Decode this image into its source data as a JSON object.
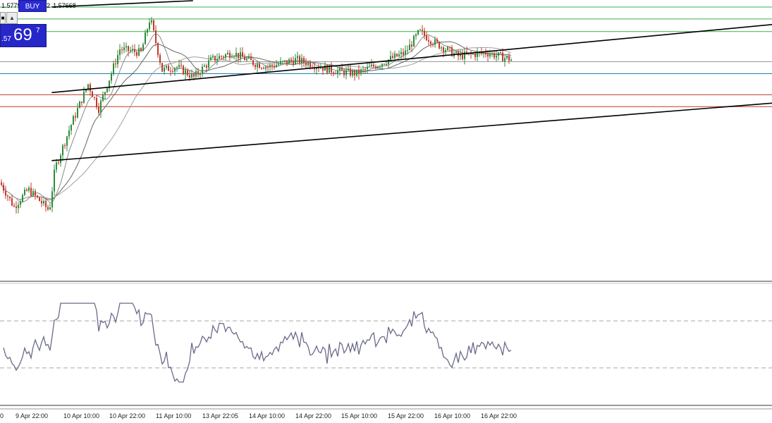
{
  "ohlc": {
    "values": [
      "1.57791",
      "1.57662",
      "1.57668"
    ]
  },
  "trade_panel": {
    "menu_glyph": "■",
    "arrow_glyph": "▲",
    "buy_label": "BUY",
    "price_prefix": ".57",
    "price_big": "69",
    "price_sup": "7"
  },
  "x_axis": {
    "labels": [
      "0",
      "9 Apr 22:00",
      "10 Apr 10:00",
      "10 Apr 22:00",
      "11 Apr 10:00",
      "13 Apr 22:05",
      "14 Apr 10:00",
      "14 Apr 22:00",
      "15 Apr 10:00",
      "15 Apr 22:00",
      "16 Apr 10:00",
      "16 Apr 22:00"
    ]
  },
  "chart_data": {
    "type": "candlestick",
    "price_range": [
      1.54,
      1.58
    ],
    "oscillator_range": [
      0,
      100
    ],
    "oscillator_levels": [
      70,
      30
    ],
    "horizontal_levels": [
      {
        "price": 1.579,
        "color": "#3bb04a"
      },
      {
        "price": 1.5773,
        "color": "#3bb04a"
      },
      {
        "price": 1.5755,
        "color": "#3bb04a"
      },
      {
        "price": 1.5712,
        "color": "#9a9a9a"
      },
      {
        "price": 1.5695,
        "color": "#1f7fa8"
      },
      {
        "price": 1.5665,
        "color": "#c0392b"
      },
      {
        "price": 1.5648,
        "color": "#c0392b"
      }
    ],
    "trendlines": [
      {
        "from": [
          0.067,
          1.579
        ],
        "to": [
          0.25,
          1.5799
        ],
        "color": "#000000"
      },
      {
        "from": [
          0.067,
          1.5668
        ],
        "to": [
          1.0,
          1.5765
        ],
        "color": "#000000"
      },
      {
        "from": [
          0.067,
          1.5571
        ],
        "to": [
          1.0,
          1.5653
        ],
        "color": "#000000"
      }
    ]
  }
}
